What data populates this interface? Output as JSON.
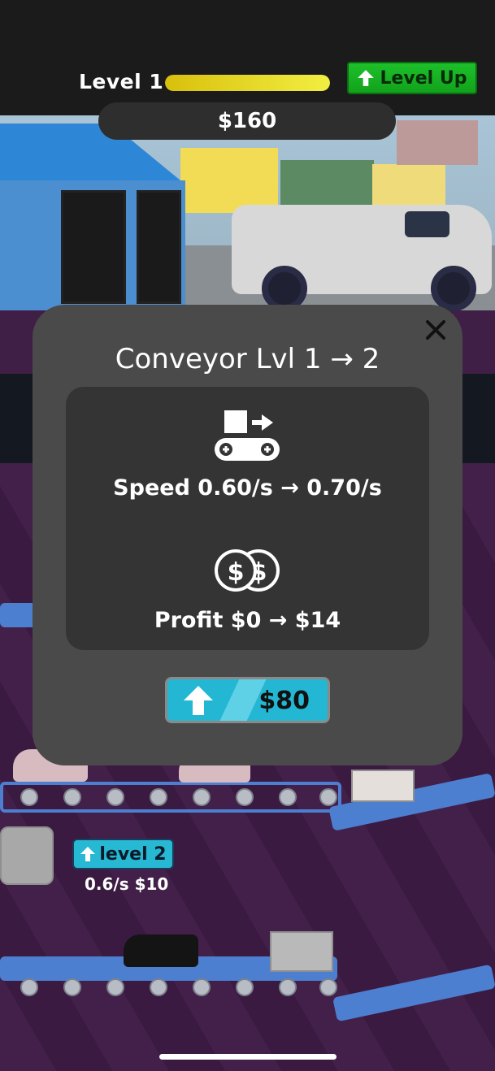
{
  "hud": {
    "level_label": "Level 1",
    "xp_progress": 1.0,
    "level_up_label": "Level Up",
    "money": "$160"
  },
  "modal": {
    "title": "Conveyor Lvl 1 → 2",
    "speed_text": "Speed 0.60/s → 0.70/s",
    "profit_text": "Profit $0 → $14",
    "buy_price": "$80",
    "icons": [
      "conveyor-icon",
      "coins-icon"
    ]
  },
  "station": {
    "tag_label": "level 2",
    "info": "0.6/s $10"
  },
  "colors": {
    "level_up_green": "#12a21c",
    "buy_cyan": "#23b7d3",
    "xp_yellow": "#f2ee42",
    "floor_purple": "#43204a"
  }
}
